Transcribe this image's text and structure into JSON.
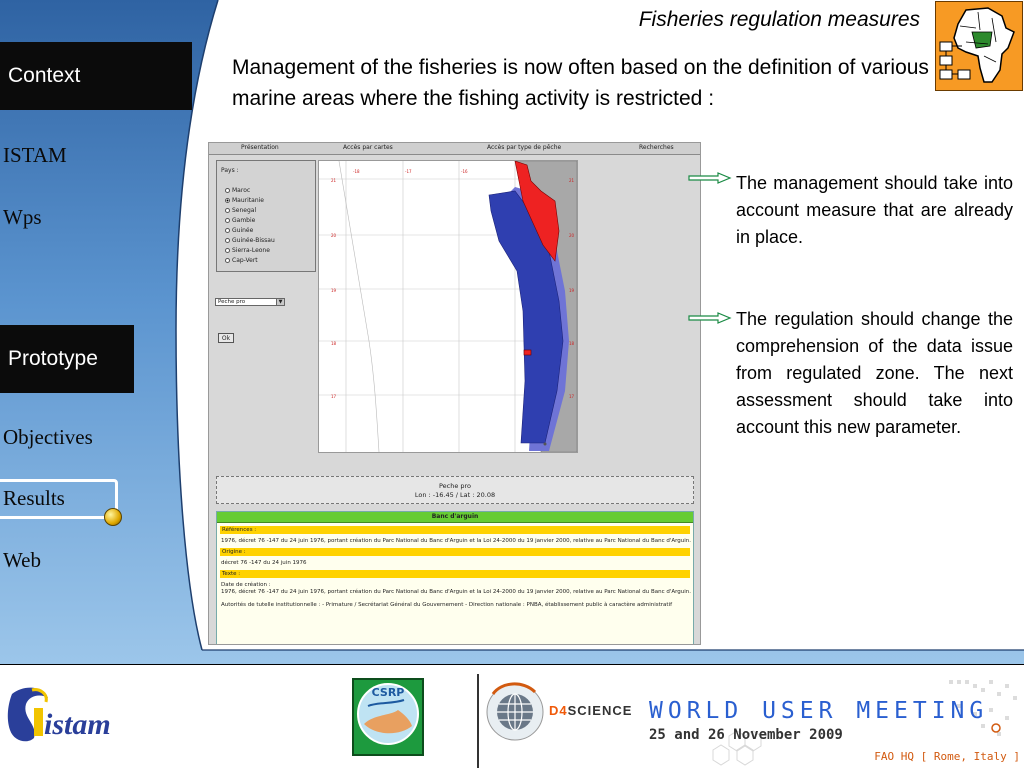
{
  "slide": {
    "title": "Fisheries regulation measures",
    "intro": "Management of the fisheries is now often based on the definition of various marine areas where the fishing activity is restricted :"
  },
  "nav": {
    "context": "Context",
    "istam": "ISTAM",
    "wps": "Wps",
    "prototype": "Prototype",
    "objectives": "Objectives",
    "results": "Results",
    "web": "Web"
  },
  "app": {
    "menu": [
      "Présentation",
      "Accès par cartes",
      "Accès par type de pêche",
      "Recherches"
    ],
    "country_label": "Pays :",
    "countries": [
      "Maroc",
      "Mauritanie",
      "Senegal",
      "Gambie",
      "Guinée",
      "Guinée-Bissau",
      "Sierra-Leone",
      "Cap-Vert"
    ],
    "selected_country": "Mauritanie",
    "fishing_type": "Peche pro",
    "ok_label": "Ok",
    "info_title": "Peche pro",
    "info_coords": "Lon : -16.45 / Lat : 20.08",
    "doc": {
      "title": "Banc d'arguin",
      "references_head": "Références :",
      "references_text": "1976, décret 76 -147 du 24 juin 1976, portant création du Parc National du Banc d'Arguin et la Loi 24-2000 du 19 janvier 2000, relative au Parc National du Banc d'Arguin.",
      "origin_head": "Origine :",
      "origin_text": "décret 76 -147 du 24 juin 1976",
      "text_head": "Texte :",
      "creation_label": "Date de création :",
      "creation_text": "1976, décret 76 -147 du 24 juin 1976, portant création du Parc National du Banc d'Arguin et la Loi 24-2000 du 19 janvier 2000, relative au Parc National du Banc d'Arguin.",
      "authorities_text": "Autorités de tutelle institutionnelle : - Primature / Secrétariat Général du Gouvernement - Direction nationale : PNBA, établissement public à caractère administratif"
    }
  },
  "notes": {
    "note1": "The management should take into account measure that are already in place.",
    "note2": "The regulation should change the comprehension of the data issue from regulated zone. The next assessment should take into account this new parameter."
  },
  "footer": {
    "istam_logo": "istam",
    "csrp_logo": "CSRP",
    "banner_brand_prefix": "D4",
    "banner_brand_suffix": "SCIENCE",
    "banner_title": "WORLD USER MEETING",
    "banner_date": "25 and 26 November 2009",
    "banner_venue": "FAO HQ [ Rome, Italy ]"
  },
  "colors": {
    "nav_blue": "#2f63a3",
    "nav_light": "#8bbbe3",
    "dark_bar": "#0b0b0b",
    "map_blue": "#2f3fb0",
    "map_red": "#ee2222",
    "header_orange": "#f79a24",
    "doc_green": "#66cc33",
    "doc_yellow": "#ffd200",
    "arrow_green": "#1a8a44"
  }
}
